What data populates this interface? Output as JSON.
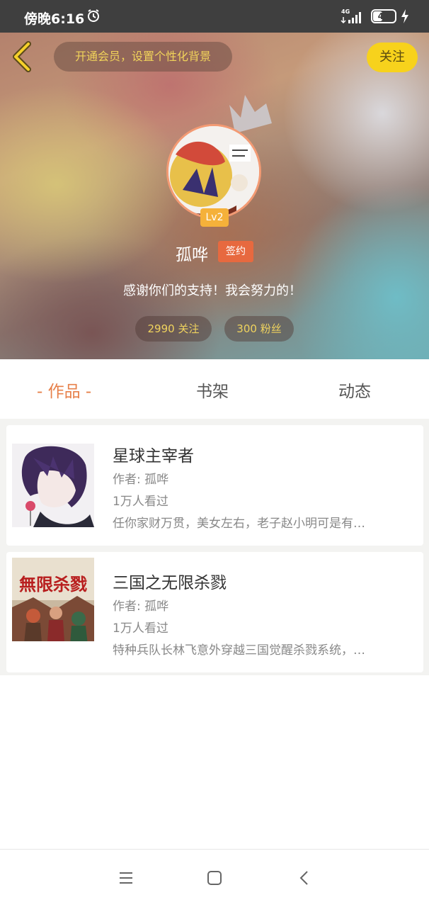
{
  "status_bar": {
    "time": "傍晚6:16",
    "network": "4G",
    "battery": "41",
    "battery_level": 0.41
  },
  "header": {
    "vip_banner": "开通会员，设置个性化背景",
    "follow_label": "关注"
  },
  "profile": {
    "level": "Lv2",
    "name": "孤哗",
    "sign_badge": "签约",
    "motto": "感谢你们的支持！我会努力的！",
    "following": "2990 关注",
    "fans": "300 粉丝"
  },
  "tabs": [
    {
      "label": "- 作品 -",
      "active": true
    },
    {
      "label": "书架",
      "active": false
    },
    {
      "label": "动态",
      "active": false
    }
  ],
  "books": [
    {
      "title": "星球主宰者",
      "author": "作者: 孤哗",
      "views": "1万人看过",
      "desc": "任你家财万贯，美女左右，老子赵小明可是有…"
    },
    {
      "title": "三国之无限杀戮",
      "author": "作者: 孤哗",
      "views": "1万人看过",
      "desc": "特种兵队长林飞意外穿越三国觉醒杀戮系统，…",
      "cover_text": "無限杀戮"
    }
  ],
  "colors": {
    "accent": "#e7804a",
    "follow_bg": "#f7d21c",
    "level_badge": "#f5b13a",
    "sign_badge": "#e7693f"
  }
}
